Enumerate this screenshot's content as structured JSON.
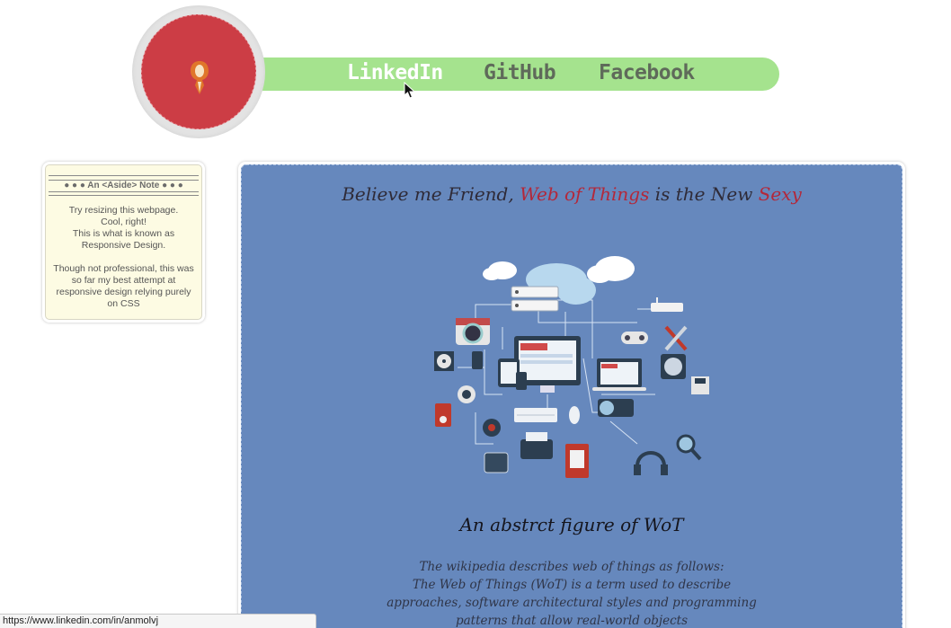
{
  "nav": {
    "links": [
      {
        "label": "LinkedIn",
        "active": true
      },
      {
        "label": "GitHub",
        "active": false
      },
      {
        "label": "Facebook",
        "active": false
      }
    ]
  },
  "aside": {
    "title": "● ● ● An <Aside> Note ● ● ●",
    "paragraph1": "Try resizing this webpage.\nCool, right!\nThis is what is known as\nResponsive Design.",
    "paragraph2": "Though not professional, this was so far my best attempt at responsive design relying purely on CSS"
  },
  "main": {
    "headline_part1": "Believe me Friend, ",
    "headline_highlight1": "Web of Things",
    "headline_part2": " is the New ",
    "headline_highlight2": "Sexy",
    "caption": "An abstrct figure of WoT",
    "description": "The wikipedia describes web of things as follows:\nThe Web of Things (WoT) is a term used to describe approaches, software architectural styles and programming patterns that allow real-world objects"
  },
  "statusbar": {
    "url": "https://www.linkedin.com/in/anmolvj"
  },
  "colors": {
    "logo_red": "#cc3d45",
    "nav_green": "#a5e38e",
    "main_blue": "#6688bd",
    "aside_yellow": "#fdfbe3",
    "accent_red": "#b3283a"
  },
  "icons": [
    "user-tie-icon",
    "cloud-icon",
    "server-icon",
    "camera-icon",
    "desktop-icon",
    "laptop-icon",
    "tablet-icon",
    "phone-icon",
    "printer-icon",
    "keyboard-icon",
    "mouse-icon",
    "headphones-icon",
    "router-icon",
    "tools-icon",
    "gamepad-icon",
    "fan-icon",
    "floppy-icon",
    "usb-icon",
    "chip-icon",
    "webcam-icon",
    "magnifier-icon",
    "smartwatch-icon",
    "hdd-icon",
    "cd-icon",
    "cursor-icon"
  ]
}
